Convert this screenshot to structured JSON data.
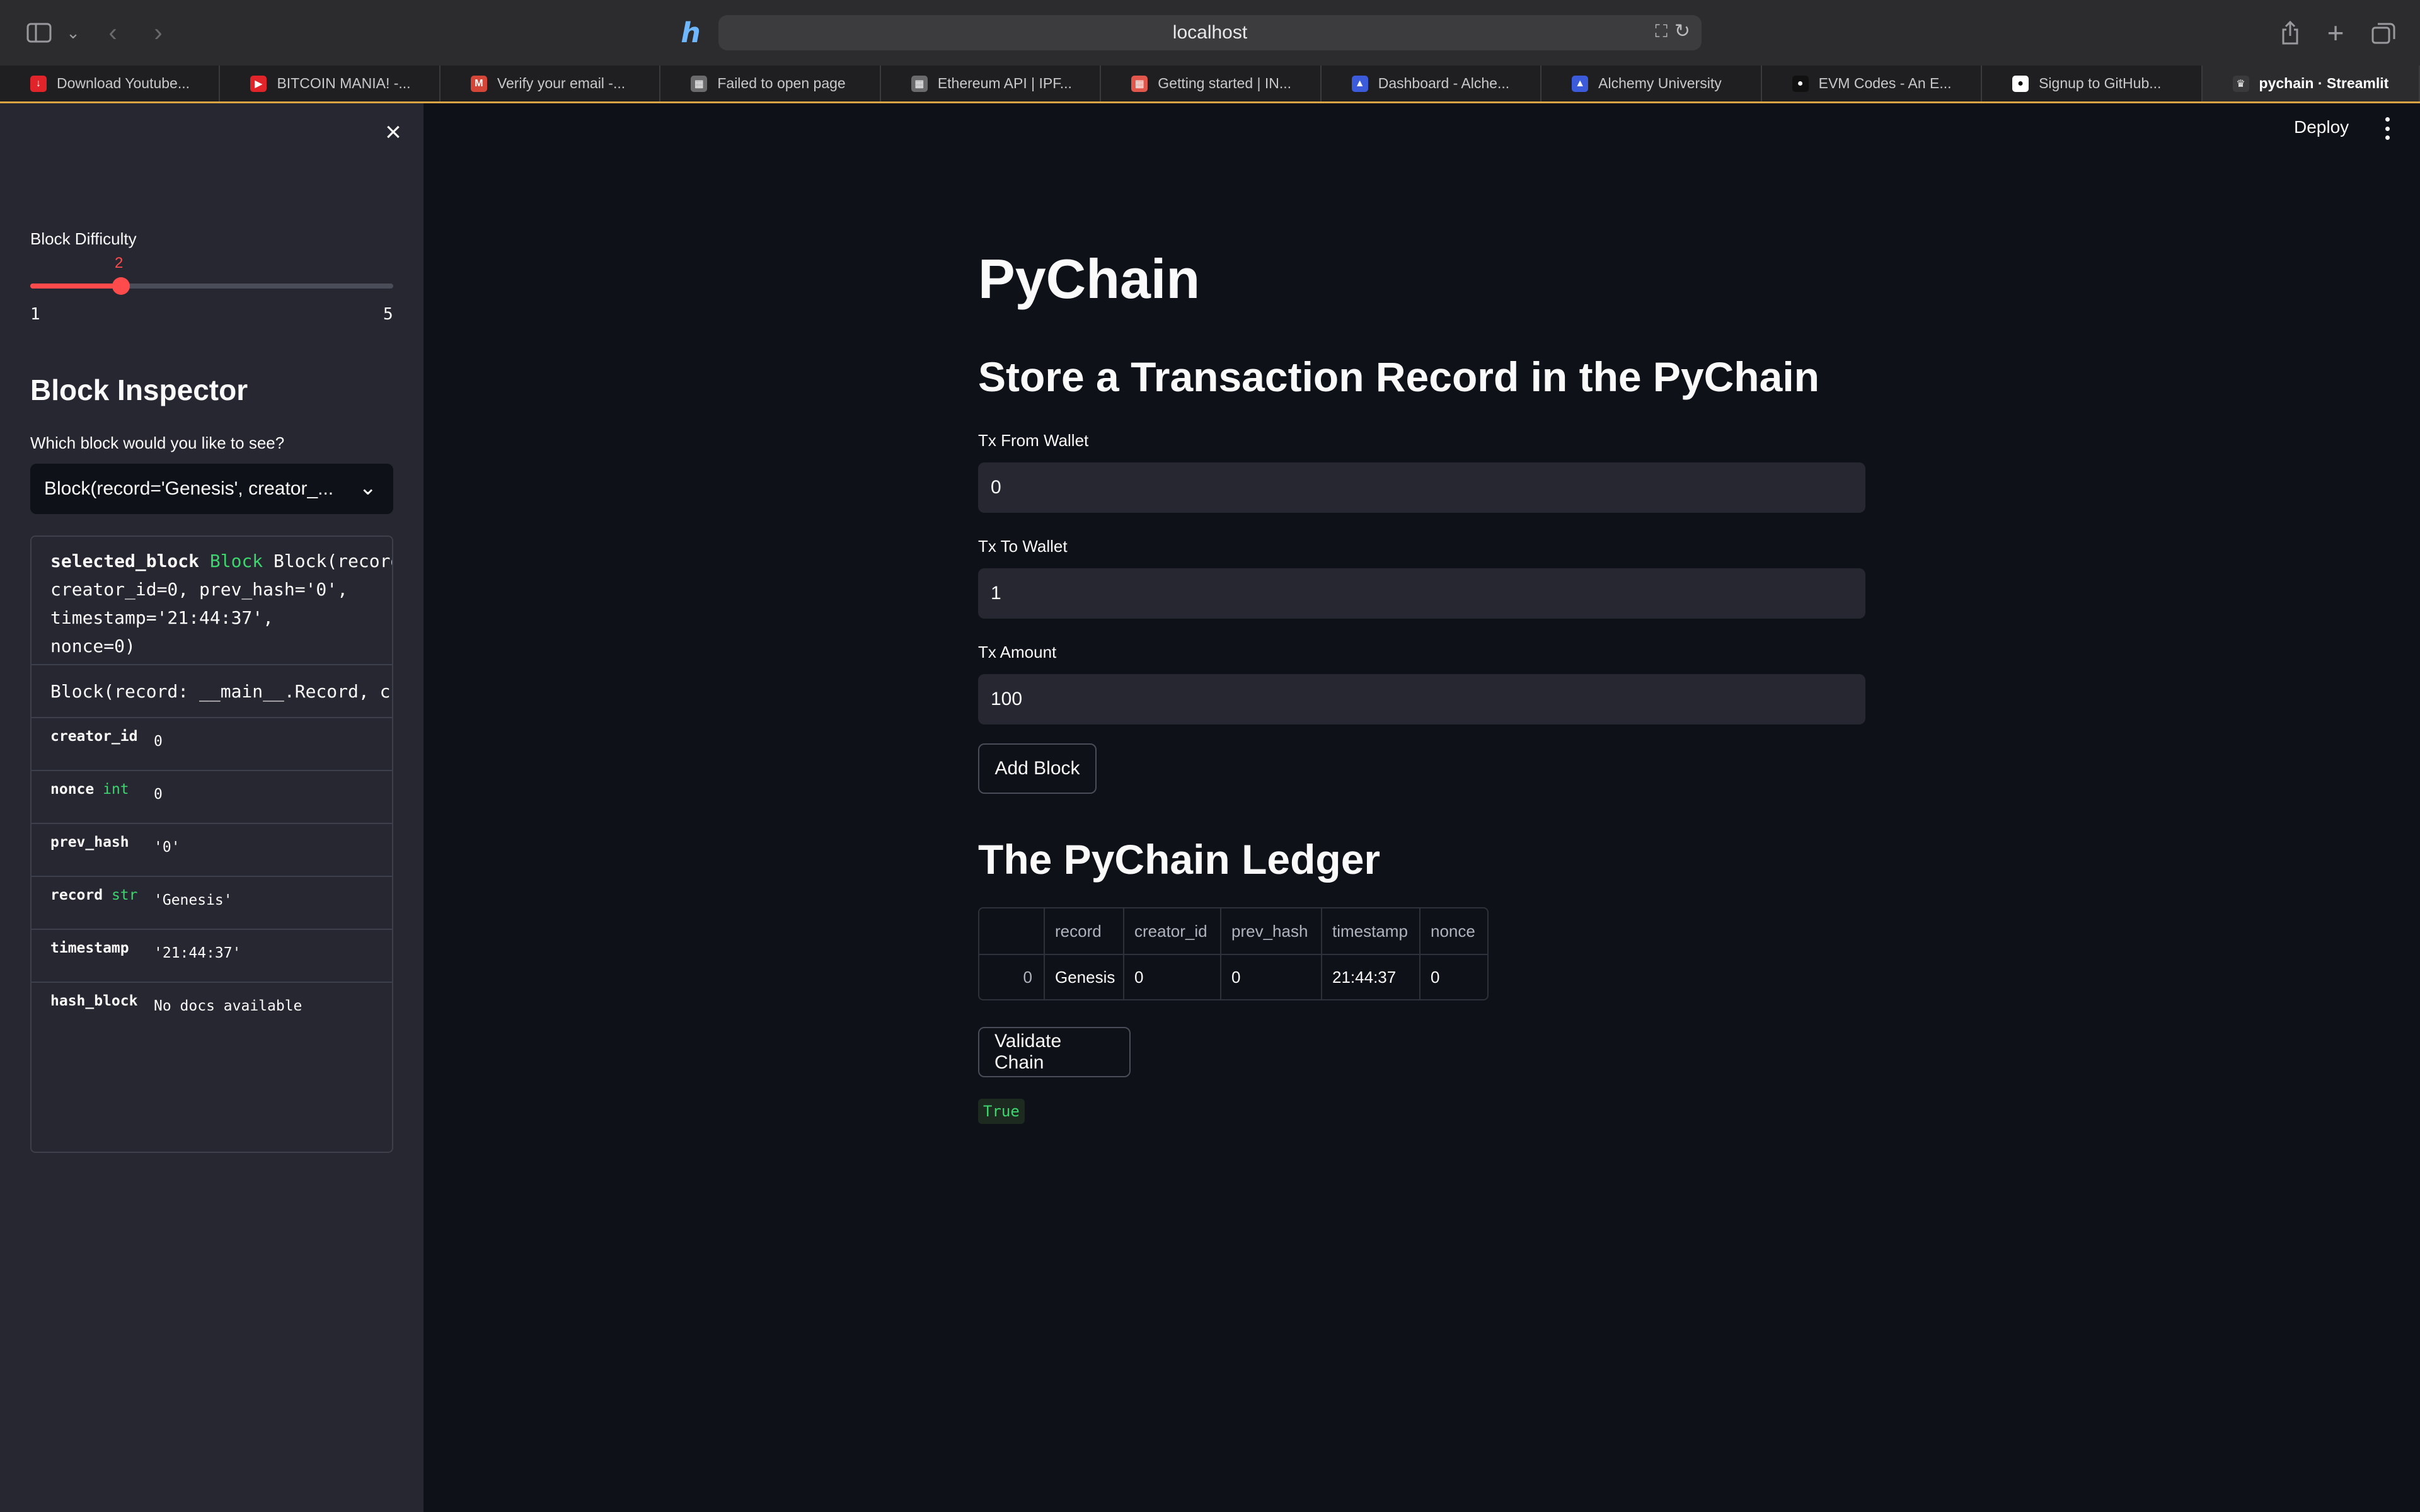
{
  "browser": {
    "url": "localhost",
    "tabs": [
      {
        "title": "Download Youtube...",
        "fav": "↓",
        "color": "#e0242a"
      },
      {
        "title": "BITCOIN MANIA! -...",
        "fav": "▶",
        "color": "#e0242a"
      },
      {
        "title": "Verify your email -...",
        "fav": "M",
        "color": "#d44638"
      },
      {
        "title": "Failed to open page",
        "fav": "▦",
        "color": "#6b6b6e"
      },
      {
        "title": "Ethereum API | IPF...",
        "fav": "▦",
        "color": "#6b6b6e"
      },
      {
        "title": "Getting started | IN...",
        "fav": "▦",
        "color": "#e2574c"
      },
      {
        "title": "Dashboard - Alche...",
        "fav": "▲",
        "color": "#3b5bdb"
      },
      {
        "title": "Alchemy University",
        "fav": "▲",
        "color": "#3b5bdb"
      },
      {
        "title": "EVM Codes - An E...",
        "fav": "●",
        "color": "#111111"
      },
      {
        "title": "Signup to GitHub...",
        "fav": "●",
        "color": "#ffffff"
      },
      {
        "title": "pychain · Streamlit",
        "fav": "♛",
        "color": "#3a3a3c"
      }
    ]
  },
  "sidebar": {
    "difficulty_label": "Block Difficulty",
    "difficulty": {
      "value": "2",
      "min": "1",
      "max": "5"
    },
    "inspector_title": "Block Inspector",
    "select_label": "Which block would you like to see?",
    "select_value": "Block(record='Genesis', creator_...",
    "help": {
      "sig_name": "selected_block",
      "sig_type": "Block",
      "sig_rest": "Block(record",
      "sig_line2": "creator_id=0, prev_hash='0',",
      "sig_line3": "timestamp='21:44:37',",
      "sig_line4": "nonce=0)",
      "doc": "Block(record: __main__.Record, c",
      "attrs": [
        {
          "key": "creator_id",
          "type": "",
          "value": "0"
        },
        {
          "key": "nonce",
          "type": "int",
          "value": "0"
        },
        {
          "key": "prev_hash",
          "type": "",
          "value": "'0'"
        },
        {
          "key": "record",
          "type": "str",
          "value": "'Genesis'"
        },
        {
          "key": "timestamp",
          "type": "",
          "value": "'21:44:37'"
        },
        {
          "key": "hash_block",
          "type": "",
          "value": "No docs available"
        }
      ]
    }
  },
  "header": {
    "deploy": "Deploy"
  },
  "main": {
    "title": "PyChain",
    "store_heading": "Store a Transaction Record in the PyChain",
    "fields": [
      {
        "label": "Tx From Wallet",
        "value": "0"
      },
      {
        "label": "Tx To Wallet",
        "value": "1"
      },
      {
        "label": "Tx Amount",
        "value": "100"
      }
    ],
    "add_block": "Add Block",
    "ledger_heading": "The PyChain Ledger",
    "table": {
      "columns": [
        "",
        "record",
        "creator_id",
        "prev_hash",
        "timestamp",
        "nonce"
      ],
      "rows": [
        [
          "0",
          "Genesis",
          "0",
          "0",
          "21:44:37",
          "0"
        ]
      ]
    },
    "validate": "Validate Chain",
    "result": "True"
  }
}
